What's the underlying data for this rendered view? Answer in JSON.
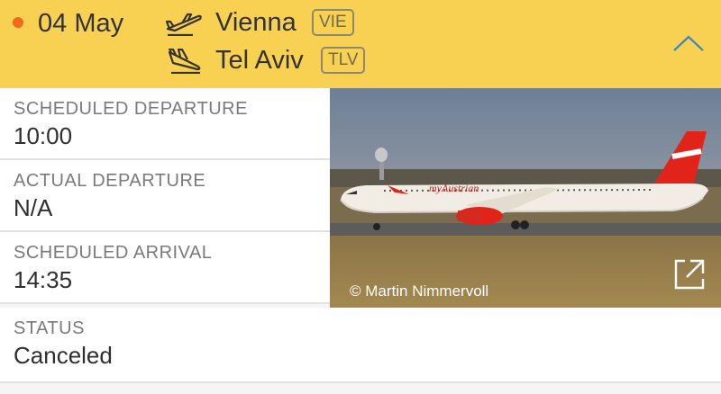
{
  "flight": {
    "date": "04 May",
    "departure": {
      "city": "Vienna",
      "code": "VIE"
    },
    "arrival": {
      "city": "Tel Aviv",
      "code": "TLV"
    }
  },
  "details": [
    {
      "label": "SCHEDULED DEPARTURE",
      "value": "10:00"
    },
    {
      "label": "ACTUAL DEPARTURE",
      "value": "N/A"
    },
    {
      "label": "SCHEDULED ARRIVAL",
      "value": "14:35"
    }
  ],
  "status": {
    "label": "STATUS",
    "value": "Canceled"
  },
  "photo": {
    "credit": "© Martin Nimmervoll",
    "livery_text": "myAustrian"
  },
  "icons": {
    "status_dot": "dot-icon",
    "departure": "plane-takeoff-icon",
    "arrival": "plane-landing-icon",
    "collapse": "chevron-up-icon",
    "external": "external-link-icon"
  },
  "colors": {
    "header_bg": "#f9d152",
    "dot": "#ee6a1c",
    "accent": "#3b82c4"
  }
}
